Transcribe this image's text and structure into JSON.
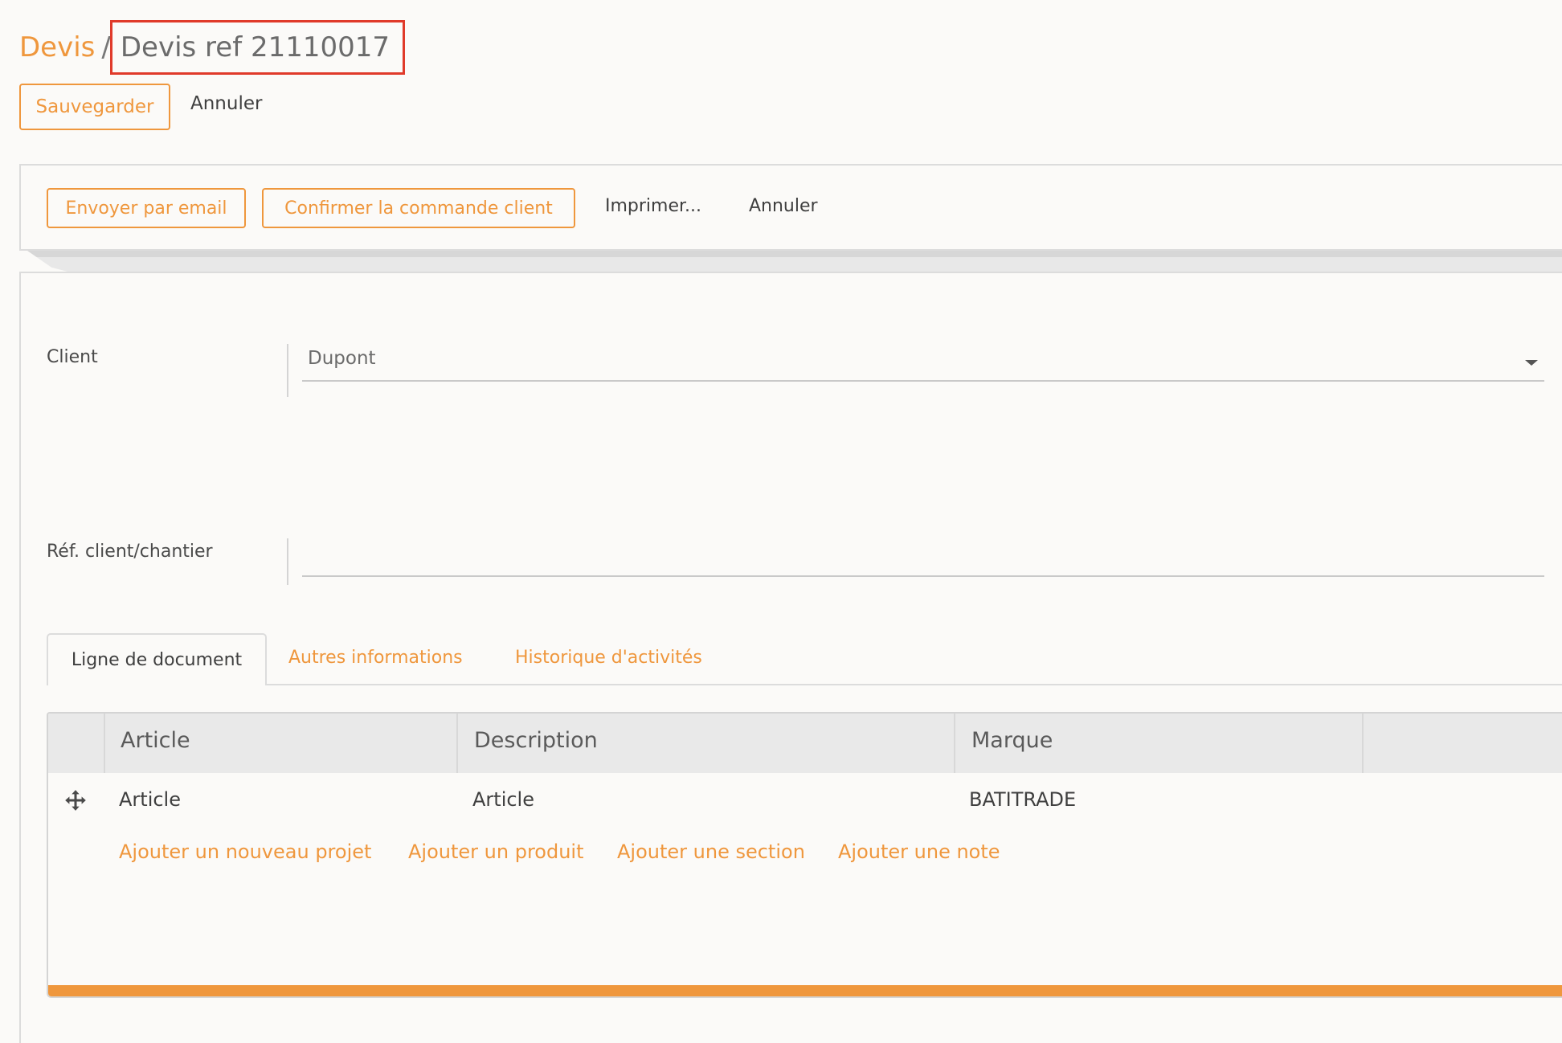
{
  "breadcrumb": {
    "parent": "Devis",
    "separator": "/",
    "current": "Devis ref 21110017"
  },
  "toolbar": {
    "save_label": "Sauvegarder",
    "cancel_label": "Annuler"
  },
  "actions": {
    "send_email": "Envoyer par email",
    "confirm_order": "Confirmer la commande client",
    "print": "Imprimer...",
    "cancel": "Annuler"
  },
  "form": {
    "client": {
      "label": "Client",
      "value": "Dupont",
      "caret_icon": "chevron-down-icon"
    },
    "reference": {
      "label": "Réf. client/chantier",
      "value": ""
    }
  },
  "tabs": [
    {
      "label": "Ligne de document",
      "active": true
    },
    {
      "label": "Autres informations",
      "active": false
    },
    {
      "label": "Historique d'activités",
      "active": false
    }
  ],
  "table": {
    "columns": [
      "",
      "Article",
      "Description",
      "Marque",
      ""
    ],
    "rows": [
      {
        "drag_icon": "move-icon",
        "article": "Article",
        "description": "Article",
        "marque": "BATITRADE"
      }
    ],
    "add_links": [
      "Ajouter un nouveau projet",
      "Ajouter un produit",
      "Ajouter une section",
      "Ajouter une note"
    ]
  },
  "colors": {
    "accent": "#ef973d",
    "highlight_box": "#e03a2a",
    "background": "#fbfaf8",
    "table_header_bg": "#e9e9e9"
  }
}
